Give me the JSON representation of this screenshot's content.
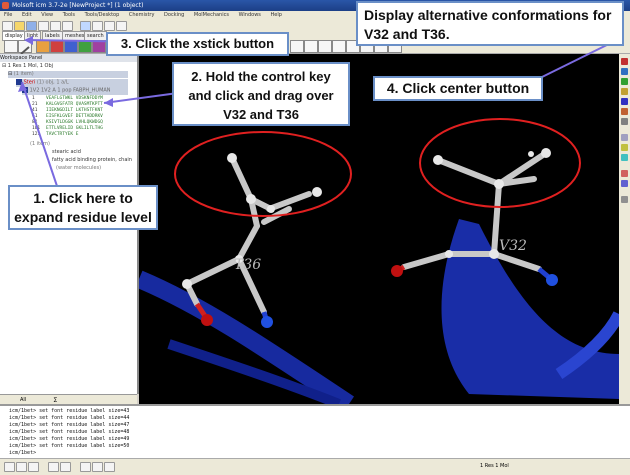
{
  "window": {
    "title": "Molsoft icm 3.7-2e [NewProject *] (1 object)"
  },
  "menu": [
    "File",
    "Edit",
    "View",
    "Tools",
    "Tools/Desktop",
    "Chemistry",
    "Docking",
    "MolMechanics",
    "Windows",
    "Help"
  ],
  "toolbar": {
    "tabs": [
      "display",
      "light",
      "labels",
      "meshes",
      "search"
    ],
    "xstick_callout": "3. Click the xstick button"
  },
  "workspace": {
    "header": "Workspace Panel",
    "root": "1 Res 1 Mol, 1 Obj",
    "item_count_a": "(1 item)",
    "object": "Steri",
    "object_info": "(1) obj, 1 a/L",
    "chain": "1V2 1V2 A 1 pop FABPH_HUMAN",
    "seq_numbers": [
      "1",
      "21",
      "41",
      "61",
      "81",
      "101",
      "121"
    ],
    "seq_lines": [
      "VEAFLGTWKL VDSKNFDDYM",
      "KALGVGFATR QVASMTKPTT",
      "IIEKNGDILT LKTHSTFKNT",
      "EISFKLGVEF DETTADDRKV",
      "KSIVTLDGGK LVHLQKWDGQ",
      "ETTLVRELID GKLILTLTHG",
      "TAVCTRTYEK E"
    ],
    "item_count_b": "(1 item)",
    "lig": "stearic acid",
    "protein": "fatty acid binding protein, chain",
    "water": "(water molecules)",
    "footer_tabs": [
      "All",
      "∑"
    ]
  },
  "callouts": {
    "c1": "1. Click here to expand residue level",
    "c2": "2. Hold the control key and click and drag over V32 and T36",
    "c3": "Display alternative conformations for V32 and T36.",
    "c4": "4. Click center button"
  },
  "viewer": {
    "label_left": "T36",
    "label_right": "V32"
  },
  "terminal": {
    "lines": [
      "icm/1bet> set font residue label size=43",
      "icm/1bet> set font residue label size=44",
      "icm/1bet> set font residue label size=47",
      "icm/1bet> set font residue label size=48",
      "icm/1bet> set font residue label size=49",
      "icm/1bet> set font residue label size=50",
      "icm/1bet>"
    ]
  },
  "status": {
    "text": "1 Res 1 Mol"
  },
  "colors": {
    "callout_border": "#6a8fc7",
    "ellipse": "#e02020",
    "ribbon": "#1a2fb0",
    "arrow": "#7a6ae0"
  }
}
